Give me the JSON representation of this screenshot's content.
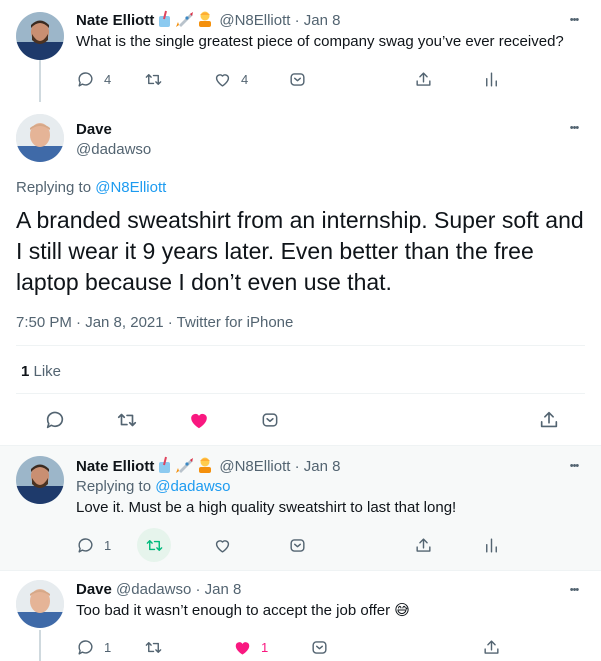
{
  "thread": {
    "root": {
      "name": "Nate Elliott",
      "handle": "@N8Elliott",
      "time": "Jan 8",
      "text": "What is the single greatest piece of company swag you’ve ever received?",
      "reply_count": "4",
      "like_count": "4"
    },
    "main": {
      "name": "Dave",
      "handle": "@dadawso",
      "replying_prefix": "Replying to ",
      "replying_to": "@N8Elliott",
      "text": "A branded sweatshirt from an internship. Super soft and I still wear it 9 years later. Even better than the free laptop because I don’t even use that.",
      "timestamp": "7:50 PM · Jan 8, 2021 · Twitter for iPhone",
      "likes_count": "1",
      "likes_label": " Like"
    },
    "reply1": {
      "name": "Nate Elliott",
      "handle": "@N8Elliott",
      "time": "Jan 8",
      "replying_prefix": "Replying to ",
      "replying_to": "@dadawso",
      "text": "Love it. Must be a high quality sweatshirt to last that long!",
      "reply_count": "1"
    },
    "reply2": {
      "name": "Dave",
      "handle": "@dadawso",
      "time": "Jan 8",
      "text": "Too bad it wasn’t enough to accept the job offer",
      "emoji": "😅",
      "reply_count": "1",
      "like_count": "1"
    }
  },
  "separators": {
    "dot": "·",
    "more": "•••"
  },
  "colors": {
    "text": "#0f1419",
    "muted": "#536471",
    "link": "#1d9bf0",
    "like_active": "#f91880",
    "retweet_active": "#00ba7c",
    "thread_line": "#cfd9de"
  },
  "icons": {
    "emojis": [
      "cup-with-straw-emoji",
      "rocket-emoji",
      "person-bowing-emoji"
    ],
    "action_bar": [
      "reply-icon",
      "retweet-icon",
      "like-icon",
      "bookmark-icon",
      "share-icon",
      "analytics-icon"
    ]
  }
}
